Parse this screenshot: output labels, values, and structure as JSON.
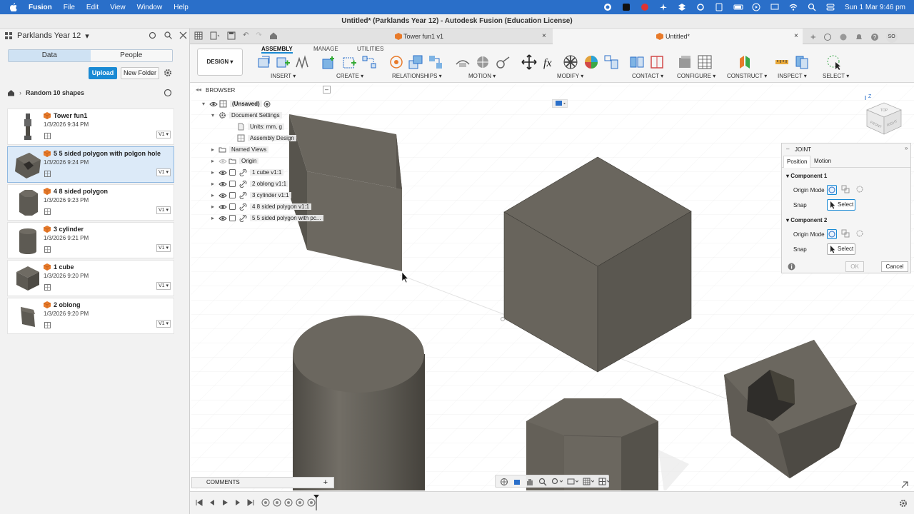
{
  "menubar": {
    "apple": "",
    "app": "Fusion",
    "items": [
      "File",
      "Edit",
      "View",
      "Window",
      "Help"
    ],
    "clock": "Sun 1 Mar  9:46 pm"
  },
  "window_title": "Untitled* (Parklands Year 12) - Autodesk Fusion (Education License)",
  "left": {
    "project": "Parklands Year 12",
    "tabs": [
      "Data",
      "People"
    ],
    "upload": "Upload",
    "new_folder": "New Folder",
    "folder": "Random 10 shapes",
    "files": [
      {
        "name": "Tower fun1",
        "date": "1/3/2026 9:34 PM",
        "version": "V1",
        "selected": false
      },
      {
        "name": "5 5 sided polygon with polgon hole",
        "date": "1/3/2026 9:24 PM",
        "version": "V1",
        "selected": true
      },
      {
        "name": "4 8 sided polygon",
        "date": "1/3/2026 9:23 PM",
        "version": "V1",
        "selected": false
      },
      {
        "name": "3 cylinder",
        "date": "1/3/2026 9:21 PM",
        "version": "V1",
        "selected": false
      },
      {
        "name": "1 cube",
        "date": "1/3/2026 9:20 PM",
        "version": "V1",
        "selected": false
      },
      {
        "name": "2 oblong",
        "date": "1/3/2026 9:20 PM",
        "version": "V1",
        "selected": false
      }
    ]
  },
  "doctabs": [
    {
      "label": "Tower fun1 v1",
      "active": false
    },
    {
      "label": "Untitled*",
      "active": true
    }
  ],
  "toolbar": {
    "workspace": "DESIGN",
    "tabs": [
      "ASSEMBLY",
      "MANAGE",
      "UTILITIES"
    ],
    "groups": [
      "INSERT",
      "CREATE",
      "RELATIONSHIPS",
      "MOTION",
      "MODIFY",
      "CONTACT",
      "CONFIGURE",
      "CONSTRUCT",
      "INSPECT",
      "SELECT"
    ]
  },
  "browser": {
    "title": "BROWSER",
    "root": "(Unsaved)",
    "items": [
      "Document Settings",
      "Units: mm, g",
      "Assembly Design",
      "Named Views",
      "Origin",
      "1 cube v1:1",
      "2 oblong v1:1",
      "3 cylinder v1:1",
      "4 8 sided polygon v1:1",
      "5 5 sided polygon with pc..."
    ]
  },
  "joint": {
    "title": "JOINT",
    "tabs": [
      "Position",
      "Motion"
    ],
    "component1": "Component 1",
    "component2": "Component 2",
    "origin_mode": "Origin Mode",
    "snap": "Snap",
    "select": "Select",
    "ok": "OK",
    "cancel": "Cancel"
  },
  "viewcube": {
    "z": "Z",
    "top": "TOP",
    "front": "FRONT",
    "right": "RIGHT"
  },
  "comments": "COMMENTS",
  "user_initials": "SO",
  "colors": {
    "accent": "#1a8ad4",
    "shape_face": "#6b675f",
    "shape_dark": "#55524b",
    "shape_light": "#807b72"
  }
}
